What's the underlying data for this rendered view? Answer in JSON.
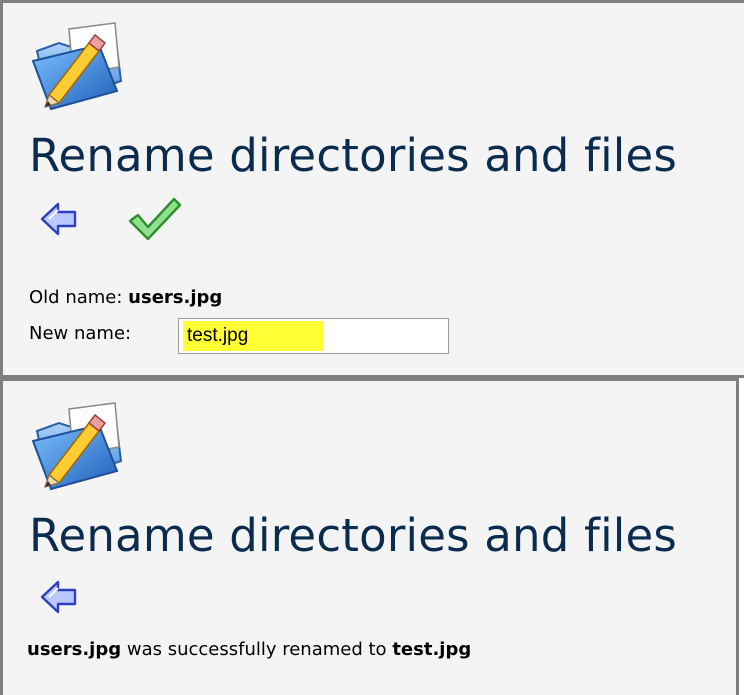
{
  "icons": {
    "folder": "folder-edit-icon",
    "back": "back-arrow-icon",
    "confirm": "checkmark-icon"
  },
  "colors": {
    "title": "#0b2c4e",
    "highlight": "#ffff33",
    "panel_bg": "#f4f4f4",
    "border": "#7f7f7f"
  },
  "rename_form": {
    "title": "Rename directories and files",
    "old_name_label": "Old name:",
    "old_name_value": "users.jpg",
    "new_name_label": "New name:",
    "new_name_value": "test.jpg"
  },
  "result": {
    "title": "Rename directories and files",
    "old_name": "users.jpg",
    "message_middle": "was successfully renamed to",
    "new_name": "test.jpg"
  }
}
